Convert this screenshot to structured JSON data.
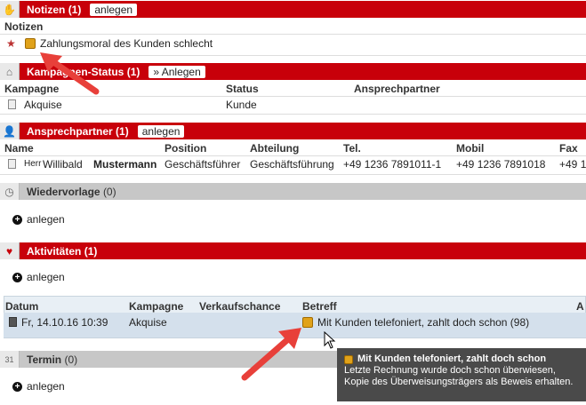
{
  "notizen": {
    "title": "Notizen",
    "count": "(1)",
    "button": "anlegen",
    "col_header": "Notizen",
    "item": "Zahlungsmoral des Kunden schlecht"
  },
  "kampagnen": {
    "title": "Kampagnen-Status",
    "count": "(1)",
    "button": "» Anlegen",
    "columns": [
      "Kampagne",
      "Status",
      "Ansprechpartner"
    ],
    "row": [
      "Akquise",
      "Kunde",
      ""
    ]
  },
  "ansprechpartner": {
    "title": "Ansprechpartner",
    "count": "(1)",
    "button": "anlegen",
    "columns": [
      "Name",
      "Position",
      "Abteilung",
      "Tel.",
      "Mobil",
      "Fax"
    ],
    "row": {
      "salutation": "Herr",
      "first": "Willibald",
      "last": "Mustermann",
      "position": "Geschäftsführer",
      "abteilung": "Geschäftsführung",
      "tel": "+49 1236 7891011-1",
      "mobil": "+49 1236 7891018",
      "fax": "+49 1"
    }
  },
  "wiedervorlage": {
    "title": "Wiedervorlage",
    "count": "(0)",
    "add": "anlegen"
  },
  "aktivitaeten": {
    "title": "Aktivitäten",
    "count": "(1)",
    "add": "anlegen",
    "columns": [
      "Datum",
      "Kampagne",
      "Verkaufschance",
      "Betreff",
      "A"
    ],
    "row": {
      "datum": "Fr, 14.10.16 10:39",
      "kampagne": "Akquise",
      "betreff": "Mit Kunden telefoniert, zahlt doch schon (98)"
    }
  },
  "termin": {
    "title": "Termin",
    "count": "(0)",
    "add": "anlegen"
  },
  "tooltip": {
    "title": "Mit Kunden telefoniert, zahlt doch schon",
    "body": "Letzte Rechnung wurde doch schon überwiesen, Kopie des Überweisungsträgers als Beweis erhalten."
  },
  "colors": {
    "section_red": "#c8000a",
    "section_gray": "#c7c7c7",
    "annotation_arrow": "#e8403a"
  }
}
